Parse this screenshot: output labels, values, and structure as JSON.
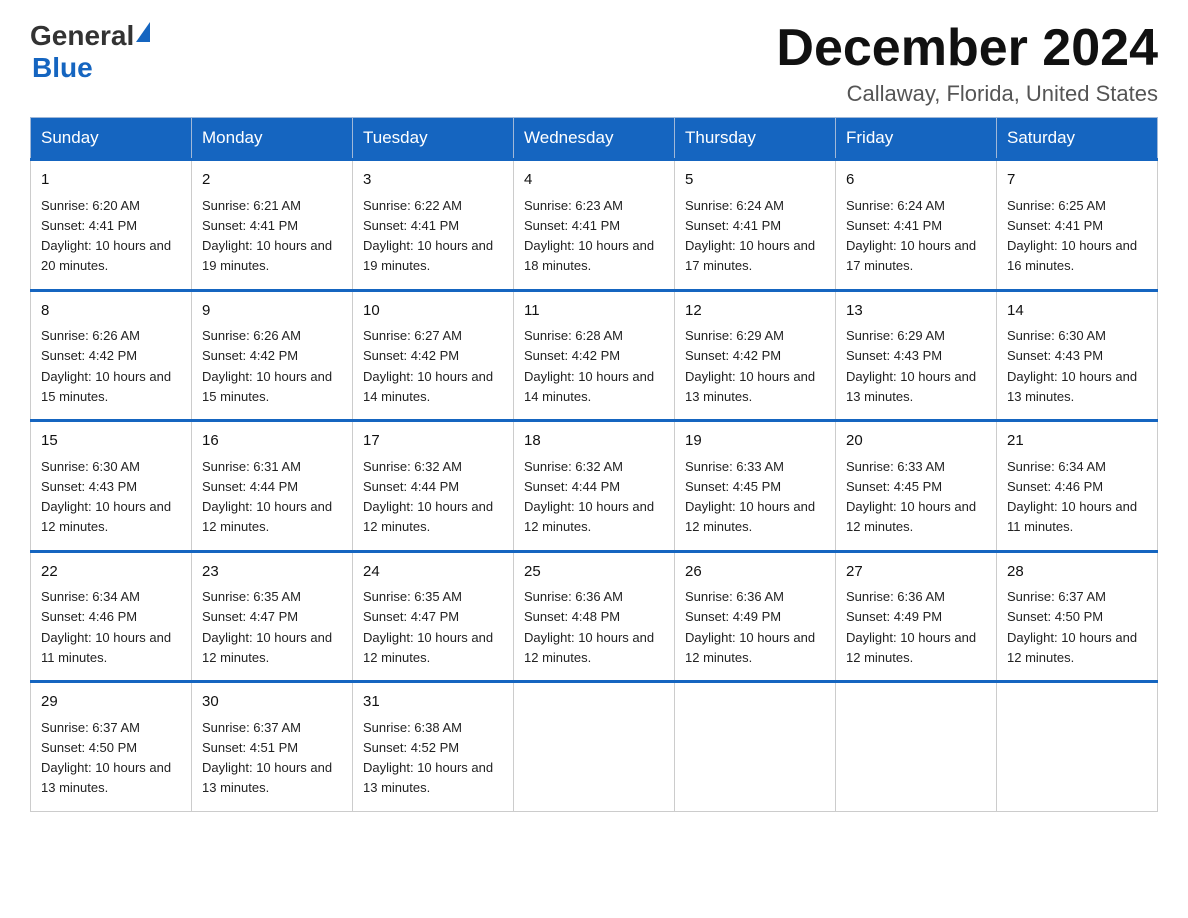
{
  "logo": {
    "general_text": "General",
    "blue_text": "Blue"
  },
  "header": {
    "month_title": "December 2024",
    "location": "Callaway, Florida, United States"
  },
  "weekdays": [
    "Sunday",
    "Monday",
    "Tuesday",
    "Wednesday",
    "Thursday",
    "Friday",
    "Saturday"
  ],
  "weeks": [
    [
      {
        "day": "1",
        "sunrise": "6:20 AM",
        "sunset": "4:41 PM",
        "daylight": "10 hours and 20 minutes."
      },
      {
        "day": "2",
        "sunrise": "6:21 AM",
        "sunset": "4:41 PM",
        "daylight": "10 hours and 19 minutes."
      },
      {
        "day": "3",
        "sunrise": "6:22 AM",
        "sunset": "4:41 PM",
        "daylight": "10 hours and 19 minutes."
      },
      {
        "day": "4",
        "sunrise": "6:23 AM",
        "sunset": "4:41 PM",
        "daylight": "10 hours and 18 minutes."
      },
      {
        "day": "5",
        "sunrise": "6:24 AM",
        "sunset": "4:41 PM",
        "daylight": "10 hours and 17 minutes."
      },
      {
        "day": "6",
        "sunrise": "6:24 AM",
        "sunset": "4:41 PM",
        "daylight": "10 hours and 17 minutes."
      },
      {
        "day": "7",
        "sunrise": "6:25 AM",
        "sunset": "4:41 PM",
        "daylight": "10 hours and 16 minutes."
      }
    ],
    [
      {
        "day": "8",
        "sunrise": "6:26 AM",
        "sunset": "4:42 PM",
        "daylight": "10 hours and 15 minutes."
      },
      {
        "day": "9",
        "sunrise": "6:26 AM",
        "sunset": "4:42 PM",
        "daylight": "10 hours and 15 minutes."
      },
      {
        "day": "10",
        "sunrise": "6:27 AM",
        "sunset": "4:42 PM",
        "daylight": "10 hours and 14 minutes."
      },
      {
        "day": "11",
        "sunrise": "6:28 AM",
        "sunset": "4:42 PM",
        "daylight": "10 hours and 14 minutes."
      },
      {
        "day": "12",
        "sunrise": "6:29 AM",
        "sunset": "4:42 PM",
        "daylight": "10 hours and 13 minutes."
      },
      {
        "day": "13",
        "sunrise": "6:29 AM",
        "sunset": "4:43 PM",
        "daylight": "10 hours and 13 minutes."
      },
      {
        "day": "14",
        "sunrise": "6:30 AM",
        "sunset": "4:43 PM",
        "daylight": "10 hours and 13 minutes."
      }
    ],
    [
      {
        "day": "15",
        "sunrise": "6:30 AM",
        "sunset": "4:43 PM",
        "daylight": "10 hours and 12 minutes."
      },
      {
        "day": "16",
        "sunrise": "6:31 AM",
        "sunset": "4:44 PM",
        "daylight": "10 hours and 12 minutes."
      },
      {
        "day": "17",
        "sunrise": "6:32 AM",
        "sunset": "4:44 PM",
        "daylight": "10 hours and 12 minutes."
      },
      {
        "day": "18",
        "sunrise": "6:32 AM",
        "sunset": "4:44 PM",
        "daylight": "10 hours and 12 minutes."
      },
      {
        "day": "19",
        "sunrise": "6:33 AM",
        "sunset": "4:45 PM",
        "daylight": "10 hours and 12 minutes."
      },
      {
        "day": "20",
        "sunrise": "6:33 AM",
        "sunset": "4:45 PM",
        "daylight": "10 hours and 12 minutes."
      },
      {
        "day": "21",
        "sunrise": "6:34 AM",
        "sunset": "4:46 PM",
        "daylight": "10 hours and 11 minutes."
      }
    ],
    [
      {
        "day": "22",
        "sunrise": "6:34 AM",
        "sunset": "4:46 PM",
        "daylight": "10 hours and 11 minutes."
      },
      {
        "day": "23",
        "sunrise": "6:35 AM",
        "sunset": "4:47 PM",
        "daylight": "10 hours and 12 minutes."
      },
      {
        "day": "24",
        "sunrise": "6:35 AM",
        "sunset": "4:47 PM",
        "daylight": "10 hours and 12 minutes."
      },
      {
        "day": "25",
        "sunrise": "6:36 AM",
        "sunset": "4:48 PM",
        "daylight": "10 hours and 12 minutes."
      },
      {
        "day": "26",
        "sunrise": "6:36 AM",
        "sunset": "4:49 PM",
        "daylight": "10 hours and 12 minutes."
      },
      {
        "day": "27",
        "sunrise": "6:36 AM",
        "sunset": "4:49 PM",
        "daylight": "10 hours and 12 minutes."
      },
      {
        "day": "28",
        "sunrise": "6:37 AM",
        "sunset": "4:50 PM",
        "daylight": "10 hours and 12 minutes."
      }
    ],
    [
      {
        "day": "29",
        "sunrise": "6:37 AM",
        "sunset": "4:50 PM",
        "daylight": "10 hours and 13 minutes."
      },
      {
        "day": "30",
        "sunrise": "6:37 AM",
        "sunset": "4:51 PM",
        "daylight": "10 hours and 13 minutes."
      },
      {
        "day": "31",
        "sunrise": "6:38 AM",
        "sunset": "4:52 PM",
        "daylight": "10 hours and 13 minutes."
      },
      null,
      null,
      null,
      null
    ]
  ]
}
